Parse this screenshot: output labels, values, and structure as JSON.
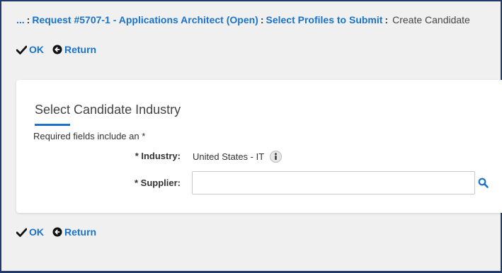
{
  "breadcrumb": {
    "ellipsis": "...",
    "request": "Request #5707-1 - Applications Architect (Open)",
    "select_profiles": "Select Profiles to Submit",
    "separator": ":",
    "current": "Create Candidate"
  },
  "toolbar": {
    "ok_label": "OK",
    "return_label": "Return"
  },
  "card": {
    "title": "Select Candidate Industry",
    "required_note": "Required fields include an *"
  },
  "fields": {
    "industry_label": "* Industry:",
    "industry_value": "United States - IT",
    "supplier_label": "* Supplier:",
    "supplier_value": ""
  },
  "colors": {
    "accent": "#1a73c9",
    "frame": "#1f3a6b",
    "background": "#f0f0f0"
  },
  "icons": {
    "ok": "checkmark-icon",
    "return": "return-arrow-icon",
    "info": "info-icon",
    "search": "search-icon"
  }
}
